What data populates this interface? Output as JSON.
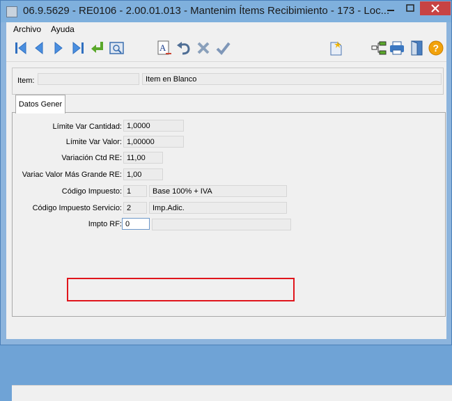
{
  "window": {
    "title": "06.9.5629 - RE0106 - 2.00.01.013 - Mantenim Ítems Recibimiento - 173 - Loc...",
    "accent": "#7fb0dd",
    "close_color": "#c74343"
  },
  "menu": {
    "items": [
      "Archivo",
      "Ayuda"
    ]
  },
  "toolbar": {
    "icons": [
      "first-record-icon",
      "previous-record-icon",
      "next-record-icon",
      "last-record-icon",
      "return-icon",
      "preview-icon",
      "font-edit-icon",
      "undo-icon",
      "cancel-icon",
      "confirm-icon",
      "new-document-icon",
      "tree-icon",
      "print-icon",
      "exit-door-icon",
      "help-icon"
    ]
  },
  "header": {
    "item_label": "Item:",
    "item_value": "",
    "item_desc": "Item en Blanco"
  },
  "tab": {
    "label": "Datos Gener"
  },
  "form": {
    "limite_var_cantidad": {
      "label": "Límite Var Cantidad:",
      "value": "1,0000"
    },
    "limite_var_valor": {
      "label": "Límite Var Valor:",
      "value": "1,00000"
    },
    "variacion_ctd_re": {
      "label": "Variación Ctd RE:",
      "value": "11,00"
    },
    "variac_valor": {
      "label": "Variac Valor Más Grande RE:",
      "value": "1,00"
    },
    "codigo_impuesto": {
      "label": "Código Impuesto:",
      "value": "1",
      "desc": "Base 100% + IVA"
    },
    "codigo_impuesto_servicio": {
      "label": "Código Impuesto Servicio:",
      "value": "2",
      "desc": "Imp.Adic."
    },
    "impto_rf": {
      "label": "Impto RF:",
      "value": "0",
      "desc": ""
    }
  },
  "highlight_color": "#e0151c"
}
